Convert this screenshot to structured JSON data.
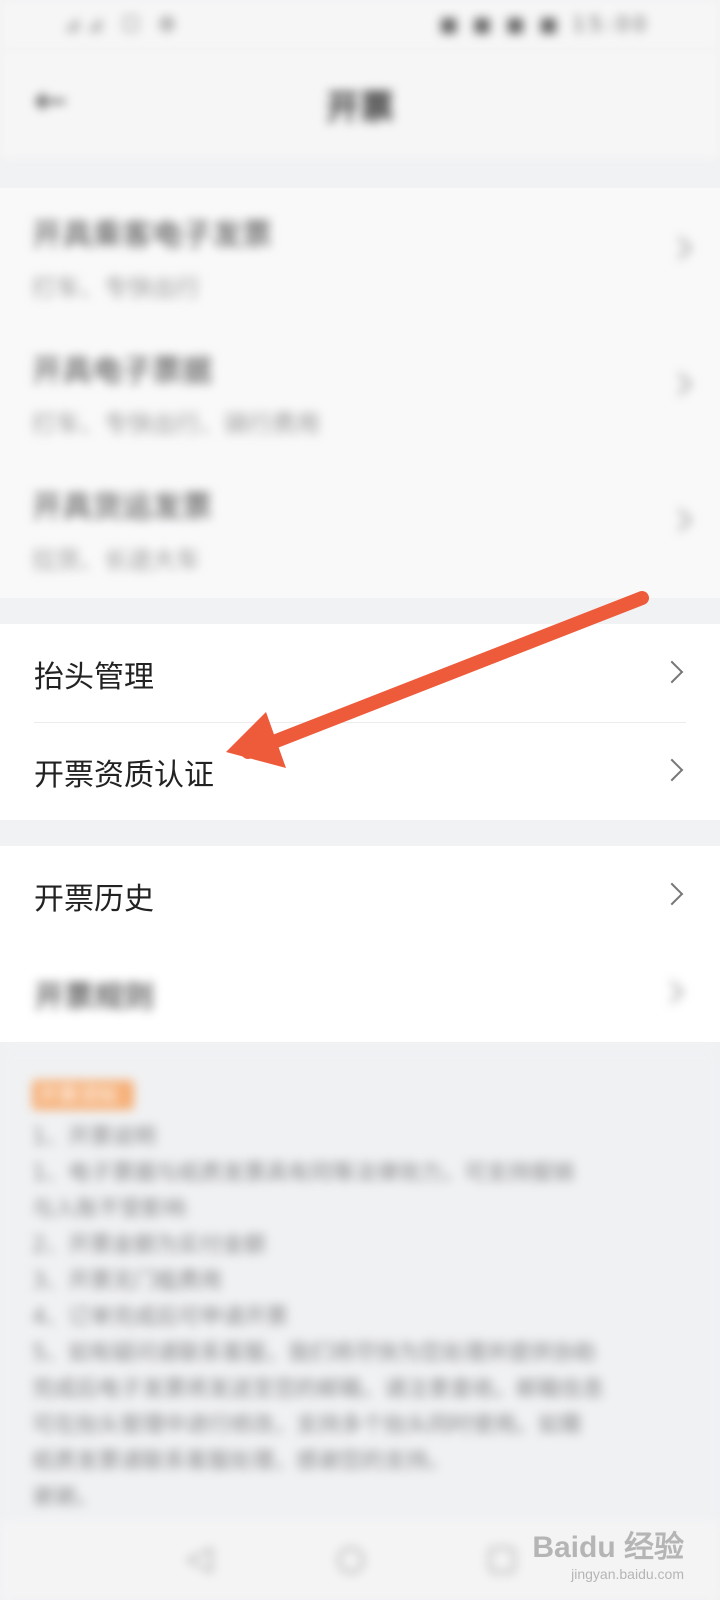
{
  "status_bar": {
    "left": "⊿⊿ ☐ ⚙",
    "right": "■ ■ ■ ■ 15:00"
  },
  "header": {
    "back_icon": "back-arrow-icon",
    "title": "开票"
  },
  "top_list": [
    {
      "title": "开具乘客电子发票",
      "subtitle": "打车、专快出行"
    },
    {
      "title": "开具电子票据",
      "subtitle": "打车、专快出行、骑行费用"
    },
    {
      "title": "开具货运发票",
      "subtitle": "拉货、长途大车"
    }
  ],
  "mid_list": [
    {
      "label": "抬头管理"
    },
    {
      "label": "开票资质认证"
    }
  ],
  "low_list": [
    {
      "label": "开票历史"
    },
    {
      "label": "开票规则"
    }
  ],
  "notice": {
    "heading": "开票须知",
    "lines": [
      "1、开票说明",
      "1、电子票据与纸质发票具有同等法律效力，可支持报销",
      "与入账不受影响",
      "2、开票金额为实付金额",
      "3、开票无门槛费用",
      "4、订单完成后可申请开票",
      "5、如有疑问请联系客服，我们将尽快为您处理并提供协助",
      "完成后电子发票将发送至您的邮箱，请注意查收。邮箱信息",
      "可在抬头管理中进行修改，支持多个抬头同时使用。如需",
      "纸质发票请联系客服处理，感谢您的支持。",
      "谢谢。"
    ]
  },
  "nav": {
    "back": "◁",
    "home": "○",
    "recent": "▢"
  },
  "watermark": {
    "brand": "Baidu 经验",
    "url": "jingyan.baidu.com"
  },
  "annotation": {
    "color": "#ee5b3b",
    "points_to": "开票资质认证"
  }
}
